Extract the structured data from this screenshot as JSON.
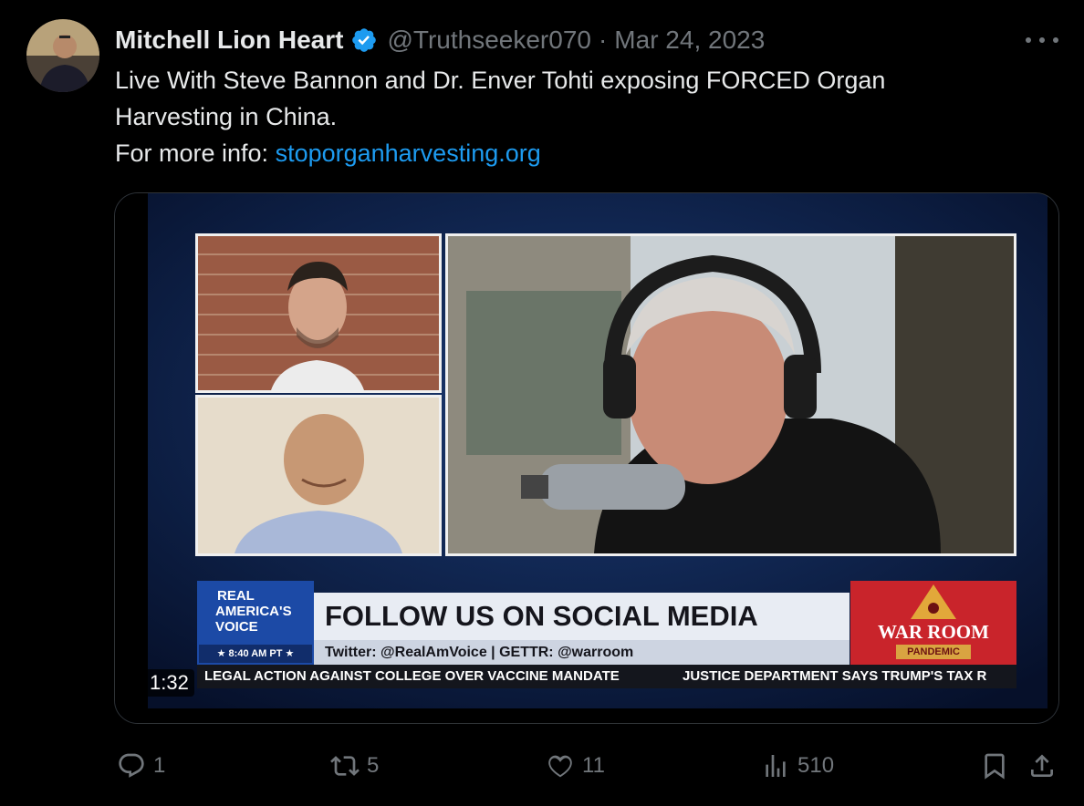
{
  "tweet": {
    "author_name": "Mitchell Lion Heart",
    "handle": "@Truthseeker070",
    "separator": "·",
    "date": "Mar 24, 2023",
    "text_line1": "Live With Steve Bannon and Dr. Enver Tohti exposing FORCED Organ",
    "text_line2": "Harvesting in China.",
    "text_line3_prefix": "For more info: ",
    "link": "stoporganharvesting.org"
  },
  "icons": {
    "verified": "verified-badge-icon",
    "more": "more-options-icon",
    "reply": "reply-icon",
    "retweet": "retweet-icon",
    "like": "heart-icon",
    "views": "views-icon",
    "bookmark": "bookmark-icon",
    "share": "share-icon"
  },
  "colors": {
    "background": "#000000",
    "text": "#e7e9ea",
    "muted": "#71767b",
    "link": "#1d9bf0",
    "verified": "#1d9bf0"
  },
  "video": {
    "duration": "1:32",
    "overlay": {
      "logo_line1": "REAL",
      "logo_line2": "AMERICA'S",
      "logo_line3": "VOICE",
      "time": "★ 8:40 AM PT ★",
      "headline": "FOLLOW US ON SOCIAL MEDIA",
      "subline": "Twitter: @RealAmVoice | GETTR: @warroom",
      "show_name": "WAR ROOM",
      "show_sub": "PANDEMIC",
      "crawl_left": "LEGAL ACTION AGAINST COLLEGE OVER VACCINE MANDATE",
      "crawl_right": "JUSTICE DEPARTMENT SAYS TRUMP'S TAX R"
    }
  },
  "actions": {
    "replies": "1",
    "retweets": "5",
    "likes": "11",
    "views": "510"
  }
}
